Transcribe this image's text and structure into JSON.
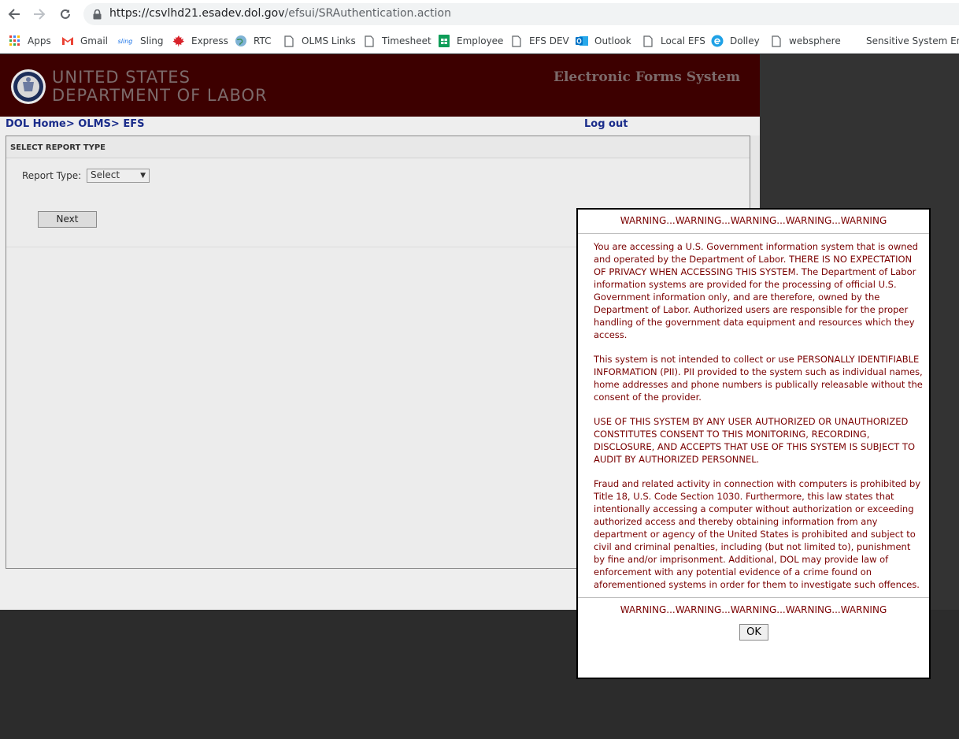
{
  "browser": {
    "url_host": "https://csvlhd21.esadev.dol.gov",
    "url_path": "/efsui/SRAuthentication.action",
    "bookmarks": [
      {
        "label": "Apps",
        "icon": "apps-grid-icon"
      },
      {
        "label": "Gmail",
        "icon": "gmail-icon"
      },
      {
        "label": "Sling",
        "icon": "sling-icon"
      },
      {
        "label": "Express",
        "icon": "maple-leaf-icon"
      },
      {
        "label": "RTC",
        "icon": "globe-icon"
      },
      {
        "label": "OLMS Links",
        "icon": "page-icon"
      },
      {
        "label": "Timesheet",
        "icon": "page-icon"
      },
      {
        "label": "Employee",
        "icon": "sheets-icon"
      },
      {
        "label": "EFS DEV",
        "icon": "page-icon"
      },
      {
        "label": "Outlook",
        "icon": "outlook-icon"
      },
      {
        "label": "Local EFS",
        "icon": "page-icon"
      },
      {
        "label": "Dolley",
        "icon": "e-icon"
      },
      {
        "label": "websphere",
        "icon": "page-icon"
      },
      {
        "label": "Sensitive System En...",
        "icon": ""
      }
    ],
    "sling_icon_text": "sling"
  },
  "header": {
    "agency_line1": "UNITED STATES",
    "agency_line2": "DEPARTMENT OF LABOR",
    "system_name": "Electronic Forms System",
    "colors": {
      "banner": "#3d0000",
      "link": "#1a2c8a",
      "warning_text": "#7a0000"
    }
  },
  "breadcrumb": {
    "dol_home": "DOL Home",
    "sep": ">",
    "olms": "OLMS",
    "efs": "EFS"
  },
  "logout": "Log out",
  "report_panel": {
    "title": "SELECT REPORT TYPE",
    "report_type_label": "Report Type:",
    "report_type_value": "Select",
    "next_label": "Next"
  },
  "modal": {
    "warning": "WARNING...WARNING...WARNING...WARNING...WARNING",
    "paragraphs": [
      "You are accessing a U.S. Government information system that is owned and operated by the Department of Labor. THERE IS NO EXPECTATION OF PRIVACY WHEN ACCESSING THIS SYSTEM. The Department of Labor information systems are provided for the processing of official U.S. Government information only, and are therefore, owned by the Department of Labor. Authorized users are responsible for the proper handling of the government data equipment and resources which they access.",
      "This system is not intended to collect or use PERSONALLY IDENTIFIABLE INFORMATION (PII). PII provided to the system such as individual names, home addresses and phone numbers is publically releasable without the consent of the provider.",
      "USE OF THIS SYSTEM BY ANY USER AUTHORIZED OR UNAUTHORIZED CONSTITUTES CONSENT TO THIS MONITORING, RECORDING, DISCLOSURE, AND ACCEPTS THAT USE OF THIS SYSTEM IS SUBJECT TO AUDIT BY AUTHORIZED PERSONNEL.",
      "Fraud and related activity in connection with computers is prohibited by Title 18, U.S. Code Section 1030. Furthermore, this law states that intentionally accessing a computer without authorization or exceeding authorized access and thereby obtaining information from any department or agency of the United States is prohibited and subject to civil and criminal penalties, including (but not limited to), punishment by fine and/or imprisonment. Additional, DOL may provide law of enforcement with any potential evidence of a crime found on aforementioned systems in order for them to investigate such offences."
    ],
    "ok_label": "OK"
  }
}
